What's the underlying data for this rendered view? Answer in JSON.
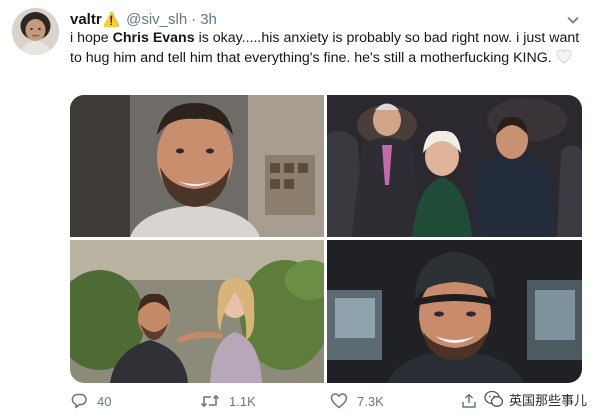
{
  "tweet": {
    "display_name": "valtr",
    "warning_emoji": "⚠️",
    "handle": "@siv_slh",
    "separator": "·",
    "time": "3h",
    "text_before": "i hope ",
    "text_bold": "Chris Evans",
    "text_after": " is okay.....his anxiety is probably so bad right now. i just want to hug him and tell him that everything's fine. he's still a motherfucking KING.",
    "heart_icon": "white-heart-icon"
  },
  "actions": {
    "replies": "40",
    "retweets": "1.1K",
    "likes": "7.3K"
  },
  "watermark": {
    "text": "英国那些事儿"
  },
  "colors": {
    "text": "#14171a",
    "secondary": "#657786",
    "warning": "#e0a800"
  }
}
